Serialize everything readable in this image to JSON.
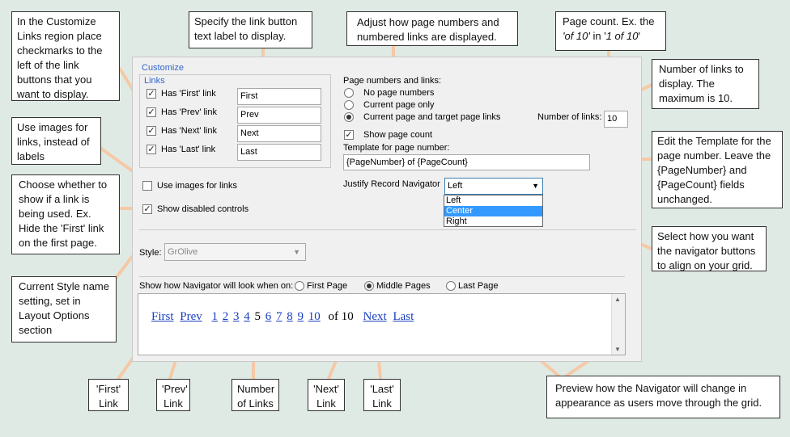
{
  "callouts": {
    "checkmarks": "In the Customize Links region place checkmarks to the left of the link buttons that you want to display.",
    "text_label": "Specify the link button text label to display.",
    "page_numbers": "Adjust how page numbers and numbered links are displayed.",
    "page_count_pre": "Page count. Ex. the ",
    "page_count_em1": "'of 10'",
    "page_count_mid": " in '",
    "page_count_em2": "1 of 10",
    "page_count_post": "'",
    "num_links": "Number of links to display. The maximum is 10.",
    "images": "Use images for links, instead of labels",
    "disabled": "Choose whether to show if a link is being used. Ex. Hide the 'First' link on the first page.",
    "template": "Edit the Template for the page number. Leave the {PageNumber} and {PageCount} fields unchanged.",
    "align": "Select how you want the navigator buttons to align on your grid.",
    "style_name": "Current Style name setting, set in Layout Options section",
    "first_link": "'First' Link",
    "prev_link": "'Prev' Link",
    "number_links": "Number of Links",
    "next_link": "'Next' Link",
    "last_link": "'Last' Link",
    "preview": "Preview how the Navigator will change in appearance as users move through the grid."
  },
  "panel": {
    "customize_title": "Customize",
    "links_title": "Links",
    "links": [
      {
        "label": "Has 'First' link",
        "value": "First",
        "checked": true
      },
      {
        "label": "Has 'Prev' link",
        "value": "Prev",
        "checked": true
      },
      {
        "label": "Has 'Next' link",
        "value": "Next",
        "checked": true
      },
      {
        "label": "Has 'Last' link",
        "value": "Last",
        "checked": true
      }
    ],
    "use_images_label": "Use images for links",
    "show_disabled_label": "Show disabled controls",
    "page_numbers_title": "Page numbers and links:",
    "radio_no_page": "No page numbers",
    "radio_current": "Current page only",
    "radio_current_target": "Current page and target page links",
    "number_of_links_label": "Number of links:",
    "number_of_links_value": "10",
    "show_page_count_label": "Show page count",
    "template_label": "Template for page number:",
    "template_value": "{PageNumber} of {PageCount}",
    "justify_label": "Justify Record Navigator",
    "justify_selected": "Left",
    "justify_options": [
      "Left",
      "Center",
      "Right"
    ],
    "style_label": "Style:",
    "style_value": "GrOlive",
    "show_how_label": "Show how Navigator will look when on:",
    "radio_first_page": "First Page",
    "radio_middle_pages": "Middle Pages",
    "radio_last_page": "Last Page"
  },
  "preview_nav": {
    "first": "First",
    "prev": "Prev",
    "pages": [
      "1",
      "2",
      "3",
      "4",
      "5",
      "6",
      "7",
      "8",
      "9",
      "10"
    ],
    "current_page": "5",
    "of_text": "of 10",
    "next": "Next",
    "last": "Last"
  },
  "colors": {
    "background": "#dfeae4",
    "connector": "#f5c9a6",
    "link": "#1a3fbf",
    "selection": "#3399ff",
    "group_title": "#3366cc"
  }
}
